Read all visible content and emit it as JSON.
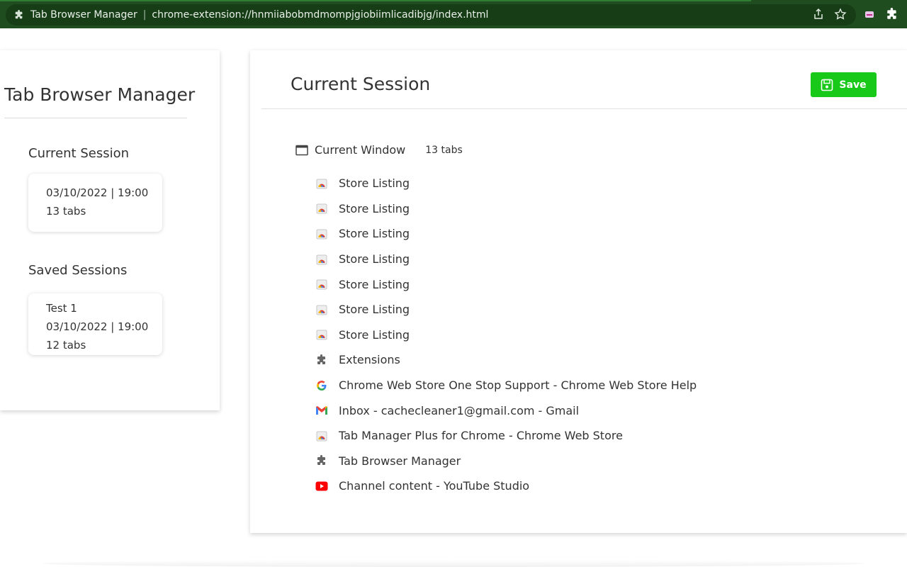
{
  "browser": {
    "site_title": "Tab Browser Manager",
    "url": "chrome-extension://hnmiiabobmdmompjgiobiimlicadibjg/index.html",
    "frame_color": "#1f4d1f"
  },
  "sidebar": {
    "app_title": "Tab Browser Manager",
    "current_section_title": "Current Session",
    "current_session": {
      "datetime": "03/10/2022 | 19:00",
      "tabs": "13 tabs"
    },
    "saved_section_title": "Saved Sessions",
    "saved_sessions": [
      {
        "name": "Test 1",
        "datetime": "03/10/2022 | 19:00",
        "tabs": "12 tabs"
      }
    ]
  },
  "main": {
    "title": "Current Session",
    "save_label": "Save",
    "save_color": "#19c919",
    "window_label": "Current Window",
    "window_tab_count": "13 tabs",
    "tabs": [
      {
        "title": "Store Listing",
        "icon": "webstore-icon"
      },
      {
        "title": "Store Listing",
        "icon": "webstore-icon"
      },
      {
        "title": "Store Listing",
        "icon": "webstore-icon"
      },
      {
        "title": "Store Listing",
        "icon": "webstore-icon"
      },
      {
        "title": "Store Listing",
        "icon": "webstore-icon"
      },
      {
        "title": "Store Listing",
        "icon": "webstore-icon"
      },
      {
        "title": "Store Listing",
        "icon": "webstore-icon"
      },
      {
        "title": "Extensions",
        "icon": "puzzle-icon"
      },
      {
        "title": "Chrome Web Store One Stop Support - Chrome Web Store Help",
        "icon": "google-icon"
      },
      {
        "title": "Inbox - cachecleaner1@gmail.com - Gmail",
        "icon": "gmail-icon"
      },
      {
        "title": "Tab Manager Plus for Chrome - Chrome Web Store",
        "icon": "webstore-icon"
      },
      {
        "title": "Tab Browser Manager",
        "icon": "puzzle-icon"
      },
      {
        "title": "Channel content - YouTube Studio",
        "icon": "youtube-icon"
      }
    ]
  }
}
